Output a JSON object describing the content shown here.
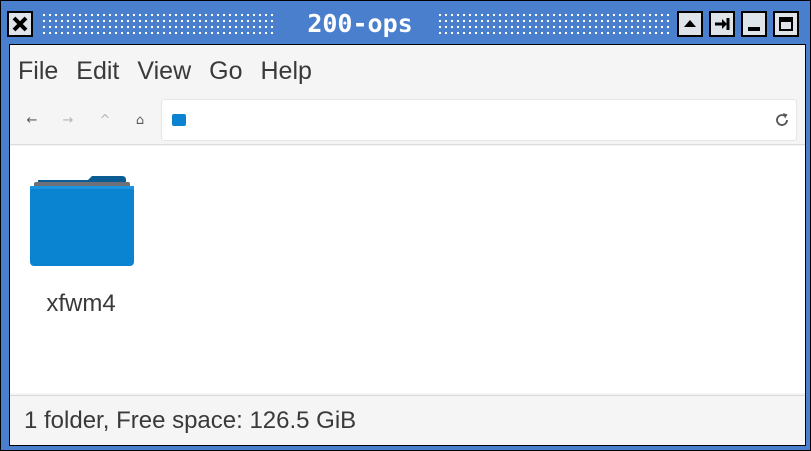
{
  "window": {
    "title": "200-ops"
  },
  "titlebar_buttons": {
    "close_icon": "x-icon",
    "shade_icon": "triangle-up-icon",
    "stick_icon": "pin-icon",
    "minimize_icon": "minimize-icon",
    "maximize_icon": "maximize-icon"
  },
  "menubar": {
    "items": [
      "File",
      "Edit",
      "View",
      "Go",
      "Help"
    ]
  },
  "toolbar": {
    "back_icon": "←",
    "forward_icon": "→",
    "up_icon": "^",
    "home_icon": "⌂",
    "path_value": ""
  },
  "files": [
    {
      "name": "xfwm4",
      "type": "folder"
    }
  ],
  "statusbar": {
    "text": "1 folder, Free space: 126.5 GiB"
  },
  "colors": {
    "titlebar": "#4a7fcd",
    "folder_blue": "#0a84d0"
  }
}
